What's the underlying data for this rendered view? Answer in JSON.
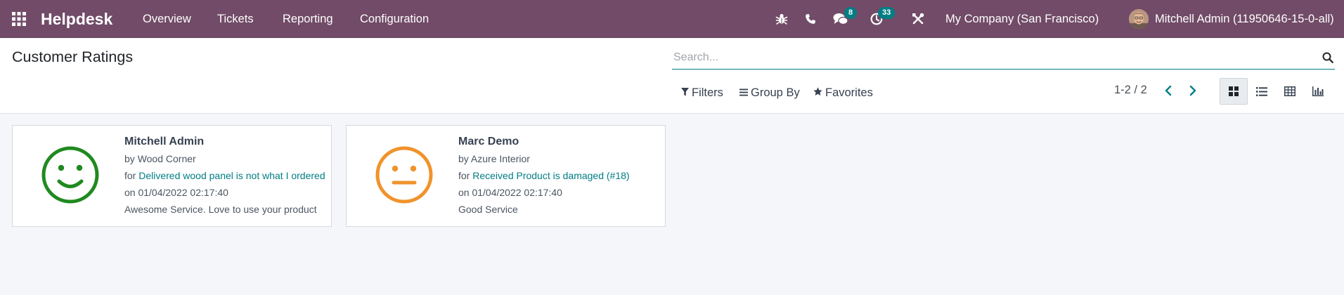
{
  "navbar": {
    "brand": "Helpdesk",
    "menu": [
      "Overview",
      "Tickets",
      "Reporting",
      "Configuration"
    ],
    "messages_badge": "8",
    "activities_badge": "33",
    "company": "My Company (San Francisco)",
    "user": "Mitchell Admin (11950646-15-0-all)",
    "icons": [
      "apps-grid-icon",
      "bug-icon",
      "phone-icon",
      "chat-icon",
      "clock-icon",
      "tools-icon"
    ]
  },
  "control_panel": {
    "title": "Customer Ratings",
    "search_placeholder": "Search...",
    "filters_label": "Filters",
    "groupby_label": "Group By",
    "favorites_label": "Favorites",
    "pager": "1-2 / 2",
    "views": [
      "kanban",
      "list",
      "pivot",
      "graph"
    ],
    "active_view": "kanban"
  },
  "ratings": [
    {
      "name": "Mitchell Admin",
      "by_prefix": "by ",
      "by": "Wood Corner",
      "for_prefix": "for ",
      "for": "Delivered wood panel is not what I ordered",
      "on": "on 01/04/2022 02:17:40",
      "feedback": "Awesome Service. Love to use your product",
      "face": "smile-face-icon",
      "color": "#1f8a1f"
    },
    {
      "name": "Marc Demo",
      "by_prefix": "by ",
      "by": "Azure Interior",
      "for_prefix": "for ",
      "for": "Received Product is damaged (#18)",
      "on": "on 01/04/2022 02:17:40",
      "feedback": "Good Service",
      "face": "neutral-face-icon",
      "color": "#f0932b"
    }
  ],
  "colors": {
    "navbar": "#714b67",
    "accent": "#017e84",
    "background": "#f5f6f9"
  }
}
